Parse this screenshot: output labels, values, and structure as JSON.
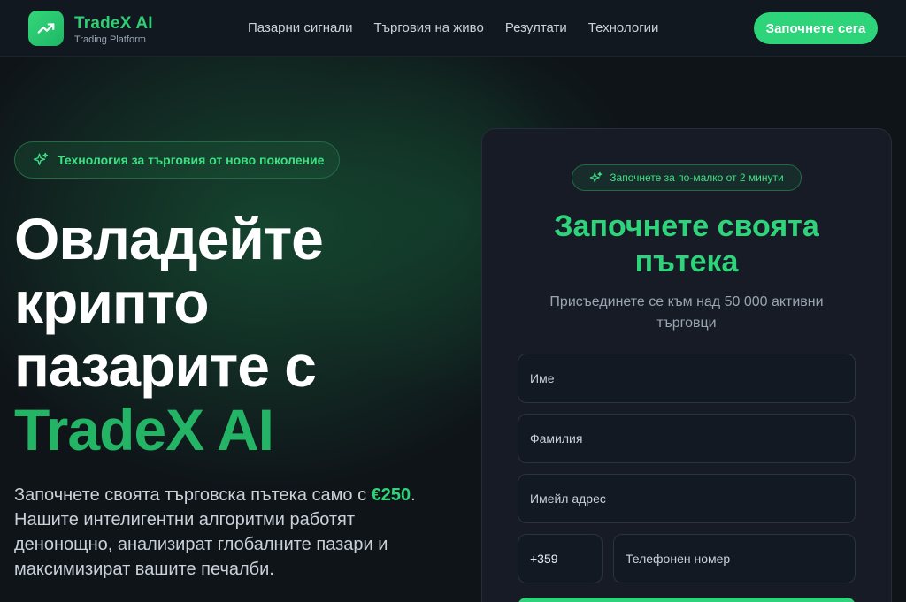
{
  "brand": {
    "name": "TradeX AI",
    "subtitle": "Trading Platform"
  },
  "nav": [
    {
      "label": "Пазарни сигнали"
    },
    {
      "label": "Търговия на живо"
    },
    {
      "label": "Резултати"
    },
    {
      "label": "Технологии"
    }
  ],
  "header_cta": "Започнете сега",
  "hero": {
    "badge": "Технология за търговия от ново поколение",
    "title_line1": "Овладейте",
    "title_line2": "крипто",
    "title_line3": "пазарите с",
    "title_accent": "TradeX AI",
    "desc_prefix": "Започнете своята търговска пътека само с ",
    "desc_amount": "€250",
    "desc_suffix": ". Нашите интелигентни алгоритми работят денонощно, анализират глобалните пазари и максимизират вашите печалби."
  },
  "form": {
    "badge": "Започнете за по-малко от 2 минути",
    "title": "Започнете своята пътека",
    "subtitle": "Присъединете се към над 50 000 активни търговци",
    "first_name_placeholder": "Име",
    "last_name_placeholder": "Фамилия",
    "email_placeholder": "Имейл адрес",
    "phone_code": "+359",
    "phone_placeholder": "Телефонен номер"
  },
  "colors": {
    "accent": "#2ed47a",
    "background": "#0f1419",
    "card": "#161b26"
  },
  "icons": {
    "logo": "trending-up-icon",
    "badge": "sparkles-icon"
  }
}
